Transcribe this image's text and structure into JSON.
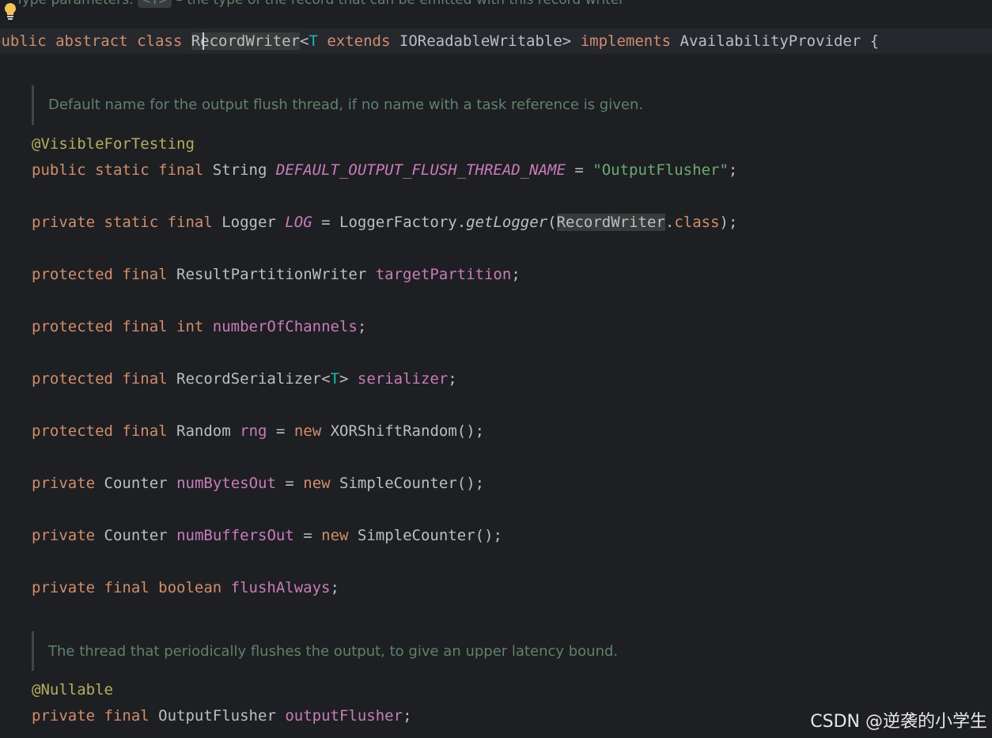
{
  "editor": {
    "top_doc": {
      "prefix": "Type parameters:",
      "chip": "<T>",
      "suffix": "– the type of the record that can be emitted with this record writer"
    },
    "class_decl": {
      "public": "public",
      "abstract": "abstract",
      "class": "class",
      "name": "RecordWriter",
      "lt": "<",
      "type_param": "T",
      "extends": "extends",
      "bound": "IOReadableWritable>",
      "implements": "implements",
      "iface": "AvailabilityProvider {"
    },
    "doc1": "Default name for the output flush thread, if no name with a task reference is given.",
    "line1_annotation": "@VisibleForTesting",
    "line2": {
      "mods": "public static final",
      "type": "String",
      "name": "DEFAULT_OUTPUT_FLUSH_THREAD_NAME",
      "eq": "=",
      "value": "\"OutputFlusher\"",
      "end": ";"
    },
    "line3": {
      "mods": "private static final",
      "type": "Logger",
      "name": "LOG",
      "eq": "=",
      "factory": "LoggerFactory.",
      "method": "getLogger",
      "paren": "(",
      "arg": "RecordWriter",
      "dot": ".",
      "class_kw": "class",
      "end": ");"
    },
    "line4": {
      "mods": "protected final",
      "type": "ResultPartitionWriter",
      "name": "targetPartition",
      "end": ";"
    },
    "line5": {
      "mods": "protected final int",
      "name": "numberOfChannels",
      "end": ";"
    },
    "line6": {
      "mods": "protected final",
      "type": "RecordSerializer<",
      "tp": "T",
      "type_end": ">",
      "name": "serializer",
      "end": ";"
    },
    "line7": {
      "mods": "protected final",
      "type": "Random",
      "name": "rng",
      "eq": "=",
      "new": "new",
      "init": "XORShiftRandom();"
    },
    "line8": {
      "mods": "private",
      "type": "Counter",
      "name": "numBytesOut",
      "eq": "=",
      "new": "new",
      "init": "SimpleCounter();"
    },
    "line9": {
      "mods": "private",
      "type": "Counter",
      "name": "numBuffersOut",
      "eq": "=",
      "new": "new",
      "init": "SimpleCounter();"
    },
    "line10": {
      "mods": "private final boolean",
      "name": "flushAlways",
      "end": ";"
    },
    "doc2": "The thread that periodically flushes the output, to give an upper latency bound.",
    "line11_annotation": "@Nullable",
    "line12": {
      "mods": "private final",
      "type": "OutputFlusher",
      "name": "outputFlusher",
      "end": ";"
    }
  },
  "watermark": "CSDN @逆袭的小学生",
  "icons": {
    "bulb": "lightbulb-icon"
  },
  "colors": {
    "background": "#1e1f22",
    "keyword": "#cf8e6d",
    "field": "#c77dbb",
    "string": "#6aab73",
    "annotation": "#b3ae60",
    "doc": "#5f826b"
  }
}
